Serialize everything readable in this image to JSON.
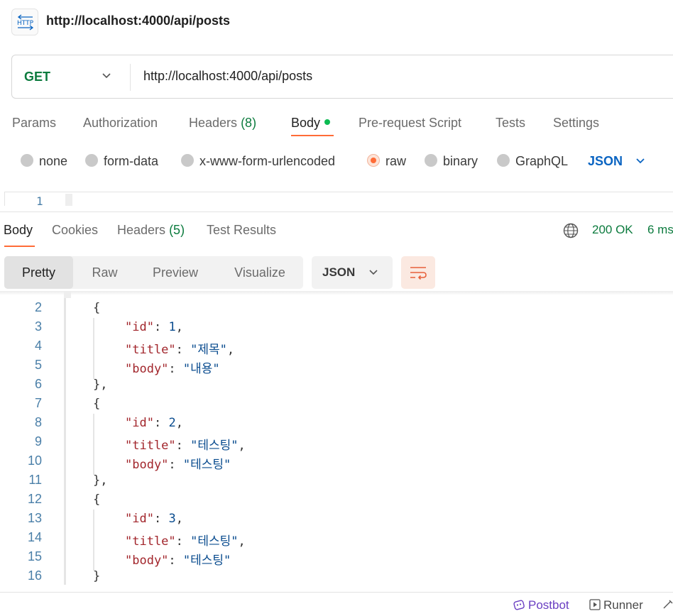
{
  "header": {
    "title": "http://localhost:4000/api/posts",
    "icon": "http-request-icon"
  },
  "request": {
    "method": "GET",
    "url": "http://localhost:4000/api/posts"
  },
  "request_tabs": [
    {
      "label": "Params"
    },
    {
      "label": "Authorization"
    },
    {
      "label": "Headers",
      "count": "(8)"
    },
    {
      "label": "Body",
      "active": true
    },
    {
      "label": "Pre-request Script"
    },
    {
      "label": "Tests"
    },
    {
      "label": "Settings"
    }
  ],
  "body_types": {
    "options": [
      "none",
      "form-data",
      "x-www-form-urlencoded",
      "raw",
      "binary",
      "GraphQL"
    ],
    "selected": "raw",
    "format": "JSON"
  },
  "request_editor": {
    "line": "1"
  },
  "response_tabs": [
    {
      "label": "Body",
      "active": true
    },
    {
      "label": "Cookies"
    },
    {
      "label": "Headers",
      "count": "(5)"
    },
    {
      "label": "Test Results"
    }
  ],
  "response_status": {
    "status": "200 OK",
    "time": "6 ms"
  },
  "response_view": {
    "modes": [
      "Pretty",
      "Raw",
      "Preview",
      "Visualize"
    ],
    "selected": "Pretty",
    "format": "JSON"
  },
  "code_lines": [
    {
      "n": "2",
      "indent": 1,
      "tokens": [
        [
          "p",
          "{"
        ]
      ]
    },
    {
      "n": "3",
      "indent": 2,
      "tokens": [
        [
          "k",
          "\"id\""
        ],
        [
          "p",
          ": "
        ],
        [
          "n",
          "1"
        ],
        [
          "p",
          ","
        ]
      ]
    },
    {
      "n": "4",
      "indent": 2,
      "tokens": [
        [
          "k",
          "\"title\""
        ],
        [
          "p",
          ": "
        ],
        [
          "s",
          "\"제목\""
        ],
        [
          "p",
          ","
        ]
      ]
    },
    {
      "n": "5",
      "indent": 2,
      "tokens": [
        [
          "k",
          "\"body\""
        ],
        [
          "p",
          ": "
        ],
        [
          "s",
          "\"내용\""
        ]
      ]
    },
    {
      "n": "6",
      "indent": 1,
      "tokens": [
        [
          "p",
          "},"
        ]
      ]
    },
    {
      "n": "7",
      "indent": 1,
      "tokens": [
        [
          "p",
          "{"
        ]
      ]
    },
    {
      "n": "8",
      "indent": 2,
      "tokens": [
        [
          "k",
          "\"id\""
        ],
        [
          "p",
          ": "
        ],
        [
          "n",
          "2"
        ],
        [
          "p",
          ","
        ]
      ]
    },
    {
      "n": "9",
      "indent": 2,
      "tokens": [
        [
          "k",
          "\"title\""
        ],
        [
          "p",
          ": "
        ],
        [
          "s",
          "\"테스팅\""
        ],
        [
          "p",
          ","
        ]
      ]
    },
    {
      "n": "10",
      "indent": 2,
      "tokens": [
        [
          "k",
          "\"body\""
        ],
        [
          "p",
          ": "
        ],
        [
          "s",
          "\"테스팅\""
        ]
      ]
    },
    {
      "n": "11",
      "indent": 1,
      "tokens": [
        [
          "p",
          "},"
        ]
      ]
    },
    {
      "n": "12",
      "indent": 1,
      "tokens": [
        [
          "p",
          "{"
        ]
      ]
    },
    {
      "n": "13",
      "indent": 2,
      "tokens": [
        [
          "k",
          "\"id\""
        ],
        [
          "p",
          ": "
        ],
        [
          "n",
          "3"
        ],
        [
          "p",
          ","
        ]
      ]
    },
    {
      "n": "14",
      "indent": 2,
      "tokens": [
        [
          "k",
          "\"title\""
        ],
        [
          "p",
          ": "
        ],
        [
          "s",
          "\"테스팅\""
        ],
        [
          "p",
          ","
        ]
      ]
    },
    {
      "n": "15",
      "indent": 2,
      "tokens": [
        [
          "k",
          "\"body\""
        ],
        [
          "p",
          ": "
        ],
        [
          "s",
          "\"테스팅\""
        ]
      ]
    },
    {
      "n": "16",
      "indent": 1,
      "tokens": [
        [
          "p",
          "}"
        ]
      ]
    }
  ],
  "footer": {
    "postbot": "Postbot",
    "runner": "Runner"
  },
  "colors": {
    "accent": "#ff6c37",
    "success": "#0c7b3e",
    "link": "#0a64c2"
  }
}
